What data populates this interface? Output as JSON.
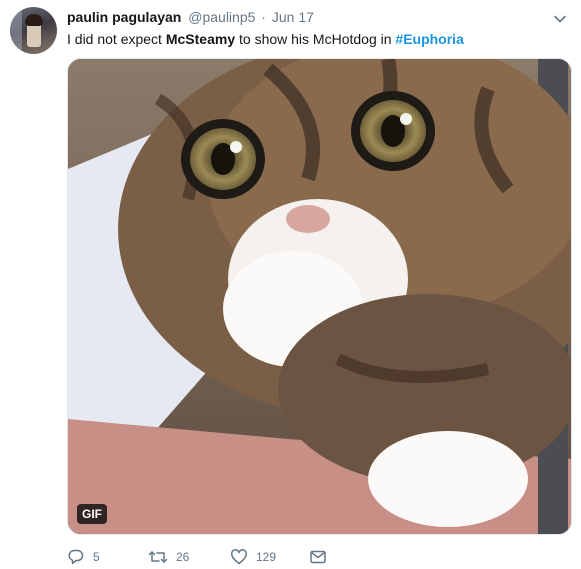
{
  "tweet": {
    "user": {
      "display_name": "paulin pagulayan",
      "handle": "@paulinp5",
      "separator": "·",
      "date": "Jun 17"
    },
    "text": {
      "part1": "I did not expect ",
      "bold": "McSteamy",
      "part2": " to show his McHotdog in ",
      "hashtag": "#Euphoria"
    },
    "media": {
      "badge": "GIF"
    },
    "actions": {
      "replies": "5",
      "retweets": "26",
      "likes": "129"
    },
    "icons": {
      "caret": "chevron-down-icon",
      "reply": "reply-icon",
      "retweet": "retweet-icon",
      "like": "heart-icon",
      "dm": "envelope-icon"
    },
    "colors": {
      "text": "#14171a",
      "muted": "#657786",
      "link": "#1b95e0"
    }
  }
}
